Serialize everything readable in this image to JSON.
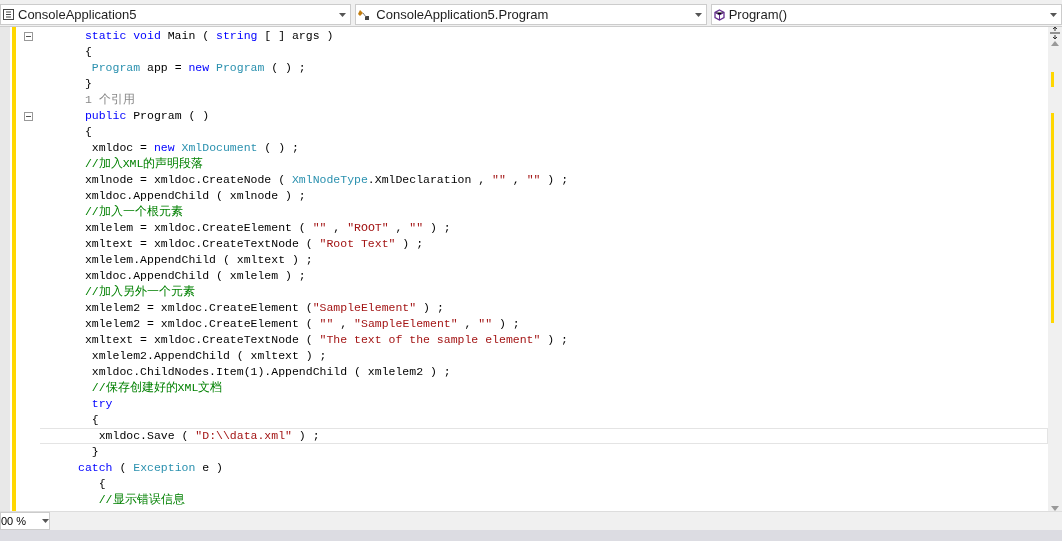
{
  "navigation_bar": [
    {
      "kind": "project",
      "text": "ConsoleApplication5"
    },
    {
      "kind": "class",
      "text": "ConsoleApplication5.Program"
    },
    {
      "kind": "method",
      "text": "Program()"
    }
  ],
  "code_lines": [
    {
      "foldable": true,
      "current": false,
      "tokens": [
        {
          "kind": "kw",
          "text": " static void "
        },
        {
          "kind": "plain",
          "text": "Main ( "
        },
        {
          "kind": "kw",
          "text": "string"
        },
        {
          "kind": "plain",
          "text": " [ ] args )"
        }
      ]
    },
    {
      "foldable": false,
      "current": false,
      "tokens": [
        {
          "kind": "plain",
          "text": " {"
        }
      ]
    },
    {
      "foldable": false,
      "current": false,
      "tokens": [
        {
          "kind": "type",
          "text": "  Program"
        },
        {
          "kind": "plain",
          "text": " app = "
        },
        {
          "kind": "kw",
          "text": "new "
        },
        {
          "kind": "type",
          "text": "Program"
        },
        {
          "kind": "plain",
          "text": " ( ) ;"
        }
      ]
    },
    {
      "foldable": false,
      "current": false,
      "tokens": [
        {
          "kind": "plain",
          "text": " }"
        }
      ]
    },
    {
      "foldable": false,
      "current": false,
      "tokens": [
        {
          "kind": "ref",
          "text": " 1 个引用"
        }
      ]
    },
    {
      "foldable": true,
      "current": false,
      "tokens": [
        {
          "kind": "kw",
          "text": " public "
        },
        {
          "kind": "plain",
          "text": "Program ( )"
        }
      ]
    },
    {
      "foldable": false,
      "current": false,
      "tokens": [
        {
          "kind": "plain",
          "text": " {"
        }
      ]
    },
    {
      "foldable": false,
      "current": false,
      "tokens": [
        {
          "kind": "plain",
          "text": "  xmldoc = "
        },
        {
          "kind": "kw",
          "text": "new "
        },
        {
          "kind": "type",
          "text": "XmlDocument"
        },
        {
          "kind": "plain",
          "text": " ( ) ;"
        }
      ]
    },
    {
      "foldable": false,
      "current": false,
      "tokens": [
        {
          "kind": "comment",
          "text": " //加入XML的声明段落"
        }
      ]
    },
    {
      "foldable": false,
      "current": false,
      "tokens": [
        {
          "kind": "plain",
          "text": " xmlnode = xmldoc.CreateNode ( "
        },
        {
          "kind": "type",
          "text": "XmlNodeType"
        },
        {
          "kind": "plain",
          "text": ".XmlDeclaration , "
        },
        {
          "kind": "str",
          "text": "\"\""
        },
        {
          "kind": "plain",
          "text": " , "
        },
        {
          "kind": "str",
          "text": "\"\""
        },
        {
          "kind": "plain",
          "text": " ) ;"
        }
      ]
    },
    {
      "foldable": false,
      "current": false,
      "tokens": [
        {
          "kind": "plain",
          "text": " xmldoc.AppendChild ( xmlnode ) ;"
        }
      ]
    },
    {
      "foldable": false,
      "current": false,
      "tokens": [
        {
          "kind": "comment",
          "text": " //加入一个根元素"
        }
      ]
    },
    {
      "foldable": false,
      "current": false,
      "tokens": [
        {
          "kind": "plain",
          "text": " xmlelem = xmldoc.CreateElement ( "
        },
        {
          "kind": "str",
          "text": "\"\""
        },
        {
          "kind": "plain",
          "text": " , "
        },
        {
          "kind": "str",
          "text": "\"ROOT\""
        },
        {
          "kind": "plain",
          "text": " , "
        },
        {
          "kind": "str",
          "text": "\"\""
        },
        {
          "kind": "plain",
          "text": " ) ;"
        }
      ]
    },
    {
      "foldable": false,
      "current": false,
      "tokens": [
        {
          "kind": "plain",
          "text": " xmltext = xmldoc.CreateTextNode ( "
        },
        {
          "kind": "str",
          "text": "\"Root Text\""
        },
        {
          "kind": "plain",
          "text": " ) ;"
        }
      ]
    },
    {
      "foldable": false,
      "current": false,
      "tokens": [
        {
          "kind": "plain",
          "text": " xmlelem.AppendChild ( xmltext ) ;"
        }
      ]
    },
    {
      "foldable": false,
      "current": false,
      "tokens": [
        {
          "kind": "plain",
          "text": " xmldoc.AppendChild ( xmlelem ) ;"
        }
      ]
    },
    {
      "foldable": false,
      "current": false,
      "tokens": [
        {
          "kind": "comment",
          "text": " //加入另外一个元素"
        }
      ]
    },
    {
      "foldable": false,
      "current": false,
      "tokens": [
        {
          "kind": "plain",
          "text": " xmlelem2 = xmldoc.CreateElement ("
        },
        {
          "kind": "str",
          "text": "\"SampleElement\""
        },
        {
          "kind": "plain",
          "text": " ) ;"
        }
      ]
    },
    {
      "foldable": false,
      "current": false,
      "tokens": [
        {
          "kind": "plain",
          "text": " xmlelem2 = xmldoc.CreateElement ( "
        },
        {
          "kind": "str",
          "text": "\"\""
        },
        {
          "kind": "plain",
          "text": " , "
        },
        {
          "kind": "str",
          "text": "\"SampleElement\""
        },
        {
          "kind": "plain",
          "text": " , "
        },
        {
          "kind": "str",
          "text": "\"\""
        },
        {
          "kind": "plain",
          "text": " ) ;"
        }
      ]
    },
    {
      "foldable": false,
      "current": false,
      "tokens": [
        {
          "kind": "plain",
          "text": " xmltext = xmldoc.CreateTextNode ( "
        },
        {
          "kind": "str",
          "text": "\"The text of the sample element\""
        },
        {
          "kind": "plain",
          "text": " ) ;"
        }
      ]
    },
    {
      "foldable": false,
      "current": false,
      "tokens": [
        {
          "kind": "plain",
          "text": "  xmlelem2.AppendChild ( xmltext ) ;"
        }
      ]
    },
    {
      "foldable": false,
      "current": false,
      "tokens": [
        {
          "kind": "plain",
          "text": "  xmldoc.ChildNodes.Item(1).AppendChild ( xmlelem2 ) ;"
        }
      ]
    },
    {
      "foldable": false,
      "current": false,
      "tokens": [
        {
          "kind": "comment",
          "text": "  //保存创建好的XML文档"
        }
      ]
    },
    {
      "foldable": false,
      "current": false,
      "tokens": [
        {
          "kind": "kw",
          "text": "  try"
        }
      ]
    },
    {
      "foldable": false,
      "current": false,
      "tokens": [
        {
          "kind": "plain",
          "text": "  {"
        }
      ]
    },
    {
      "foldable": false,
      "current": true,
      "tokens": [
        {
          "kind": "plain",
          "text": "   xmldoc.Save ( "
        },
        {
          "kind": "str",
          "text": "\"D:\\\\data.xml\""
        },
        {
          "kind": "plain",
          "text": " ) ;"
        }
      ]
    },
    {
      "foldable": false,
      "current": false,
      "tokens": [
        {
          "kind": "plain",
          "text": "  }"
        }
      ]
    },
    {
      "foldable": false,
      "current": false,
      "tokens": [
        {
          "kind": "kw",
          "text": "catch"
        },
        {
          "kind": "plain",
          "text": " ( "
        },
        {
          "kind": "type",
          "text": "Exception"
        },
        {
          "kind": "plain",
          "text": " e )"
        }
      ]
    },
    {
      "foldable": false,
      "current": false,
      "tokens": [
        {
          "kind": "plain",
          "text": "   {"
        }
      ]
    },
    {
      "foldable": false,
      "current": false,
      "tokens": [
        {
          "kind": "comment",
          "text": "   //显示错误信息"
        }
      ]
    }
  ],
  "zoom": {
    "value": "00 %"
  }
}
